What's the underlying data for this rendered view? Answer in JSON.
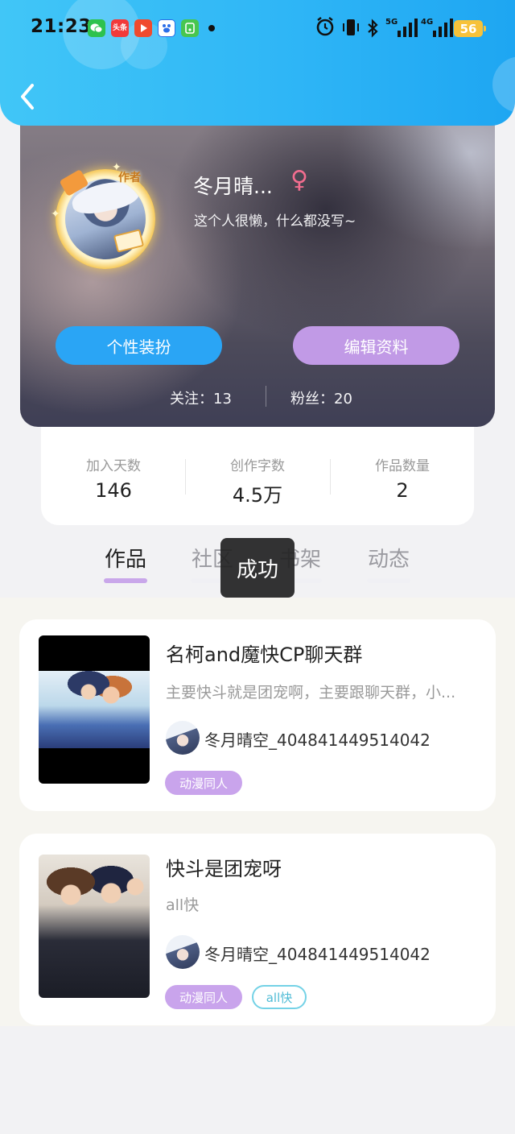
{
  "status_bar": {
    "time": "21:23",
    "app_icons": [
      "wechat-icon",
      "toutiao-icon",
      "video-icon",
      "baidu-icon",
      "game-icon"
    ],
    "toutiao_label": "头条",
    "battery": "56",
    "network_5g": "5G",
    "network_4g": "4G"
  },
  "profile": {
    "author_badge": "作者",
    "name": "冬月晴...",
    "gender_symbol": "♀",
    "bio": "这个人很懒，什么都没写~",
    "outfit_button": "个性装扮",
    "edit_button": "编辑资料",
    "following": "关注：13",
    "fans": "粉丝：20"
  },
  "stats": [
    {
      "label": "加入天数",
      "value": "146"
    },
    {
      "label": "创作字数",
      "value": "4.5万"
    },
    {
      "label": "作品数量",
      "value": "2"
    }
  ],
  "tabs": [
    {
      "label": "作品",
      "active": true
    },
    {
      "label": "社区",
      "active": false
    },
    {
      "label": "书架",
      "active": false
    },
    {
      "label": "动态",
      "active": false
    }
  ],
  "toast": "成功",
  "works": [
    {
      "title": "名柯and魔快CP聊天群",
      "description": "主要快斗就是团宠啊，主要跟聊天群，小...",
      "author": "冬月晴空_404841449514042",
      "tags": [
        "动漫同人"
      ]
    },
    {
      "title": "快斗是团宠呀",
      "description": "all快",
      "author": "冬月晴空_404841449514042",
      "tags": [
        "动漫同人",
        "all快"
      ]
    }
  ],
  "colors": {
    "header": "#2fb6f6",
    "outfit_button": "#2aa5f5",
    "edit_button": "#c19ae6",
    "tag": "#c9a4ec",
    "tab_underline": "#c9a7ea",
    "gender": "#f26d8f"
  }
}
